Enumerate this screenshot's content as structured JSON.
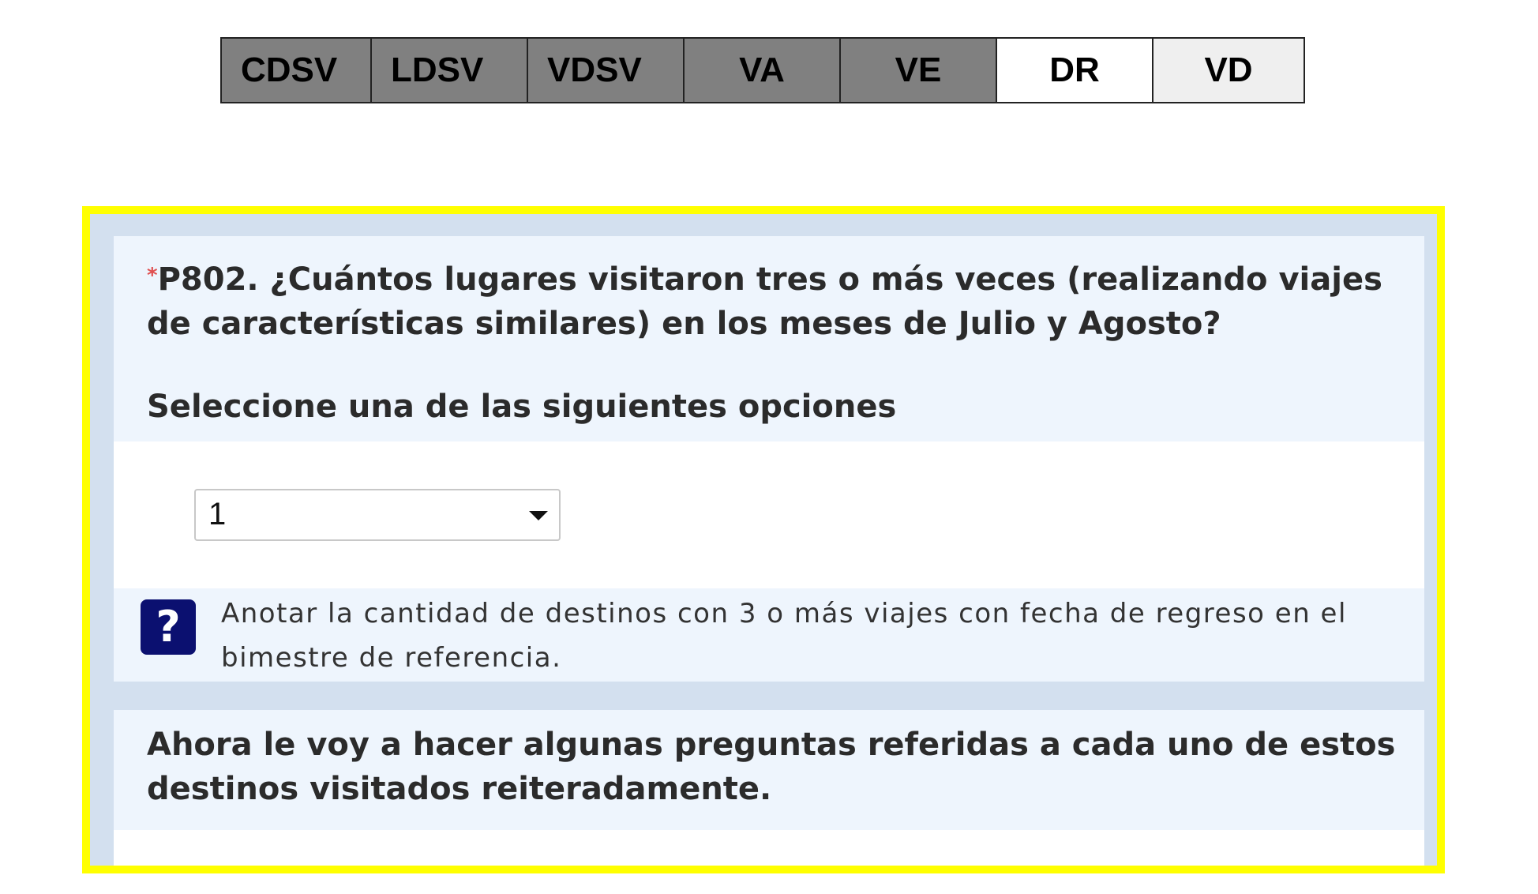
{
  "tabs": [
    {
      "label": "CDSV",
      "state": "completed"
    },
    {
      "label": "LDSV",
      "state": "completed"
    },
    {
      "label": "VDSV",
      "state": "completed"
    },
    {
      "label": "VA",
      "state": "completed"
    },
    {
      "label": "VE",
      "state": "completed"
    },
    {
      "label": "DR",
      "state": "current"
    },
    {
      "label": "VD",
      "state": "pending"
    }
  ],
  "question": {
    "required_mark": "*",
    "text": "P802. ¿Cuántos lugares visitaron tres o más veces (realizando viajes de características similares)  en los meses de Julio y Agosto?",
    "instruction": "Seleccione una de las siguientes opciones"
  },
  "answer": {
    "selected_value": "1",
    "dropdown_icon": "chevron-down-icon"
  },
  "help": {
    "icon_glyph": "?",
    "text": "Anotar la cantidad de destinos con 3 o más viajes con fecha de regreso en el bimestre de referencia."
  },
  "intro": {
    "text": "Ahora le voy a hacer algunas preguntas referidas a cada uno de estos destinos visitados reiteradamente."
  },
  "colors": {
    "highlight_border": "#ffff00",
    "completed_tab": "#808080",
    "current_tab": "#ffffff",
    "pending_tab": "#efefef",
    "panel_background": "#eef5fd",
    "panel_frame": "#d3e0ef",
    "help_icon": "#0b1070",
    "required_mark": "#e05050"
  }
}
